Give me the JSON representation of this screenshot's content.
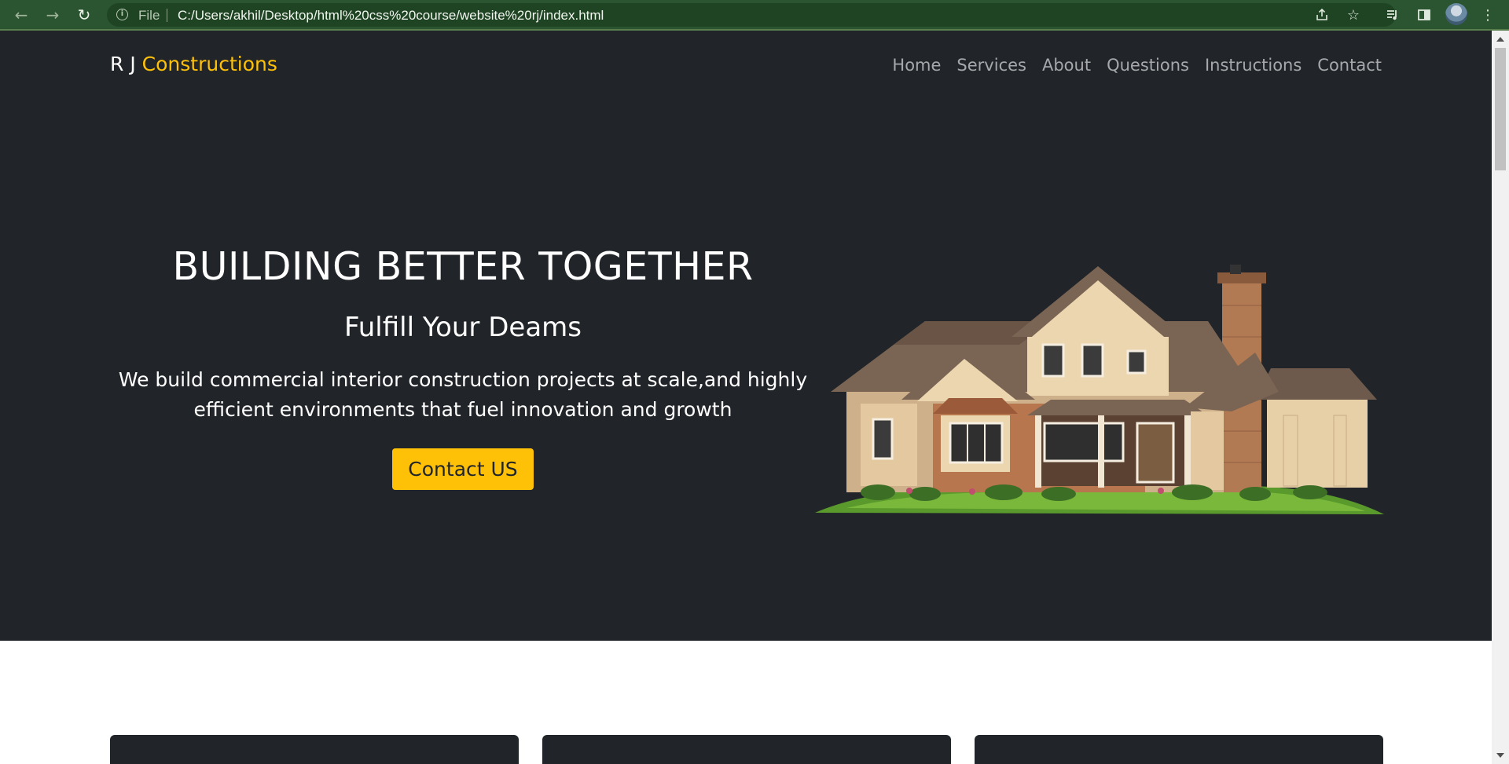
{
  "browser": {
    "scheme_label": "File",
    "url": "C:/Users/akhil/Desktop/html%20css%20course/website%20rj/index.html",
    "icons": {
      "back": "back-arrow-icon",
      "forward": "forward-arrow-icon",
      "reload": "reload-icon",
      "info": "info-icon",
      "share": "share-icon",
      "bookmark": "star-icon",
      "media": "media-queue-icon",
      "side_panel": "side-panel-icon",
      "profile": "profile-avatar",
      "menu": "kebab-menu-icon"
    },
    "colors": {
      "frame": "#2b5430",
      "omnibox": "#1f4424"
    }
  },
  "site": {
    "brand_prefix": "R J",
    "brand_accent": "Constructions",
    "nav": [
      "Home",
      "Services",
      "About",
      "Questions",
      "Instructions",
      "Contact"
    ],
    "hero": {
      "title": "BUILDING BETTER TOGETHER",
      "subtitle": "Fulfill Your Deams",
      "description": "We build commercial interior construction projects at scale,and highly efficient environments that fuel innovation and growth",
      "cta_label": "Contact US",
      "image": "house-image"
    },
    "colors": {
      "hero_bg": "#212529",
      "accent": "#ffc107",
      "nav_text": "#a6a8ab"
    }
  }
}
